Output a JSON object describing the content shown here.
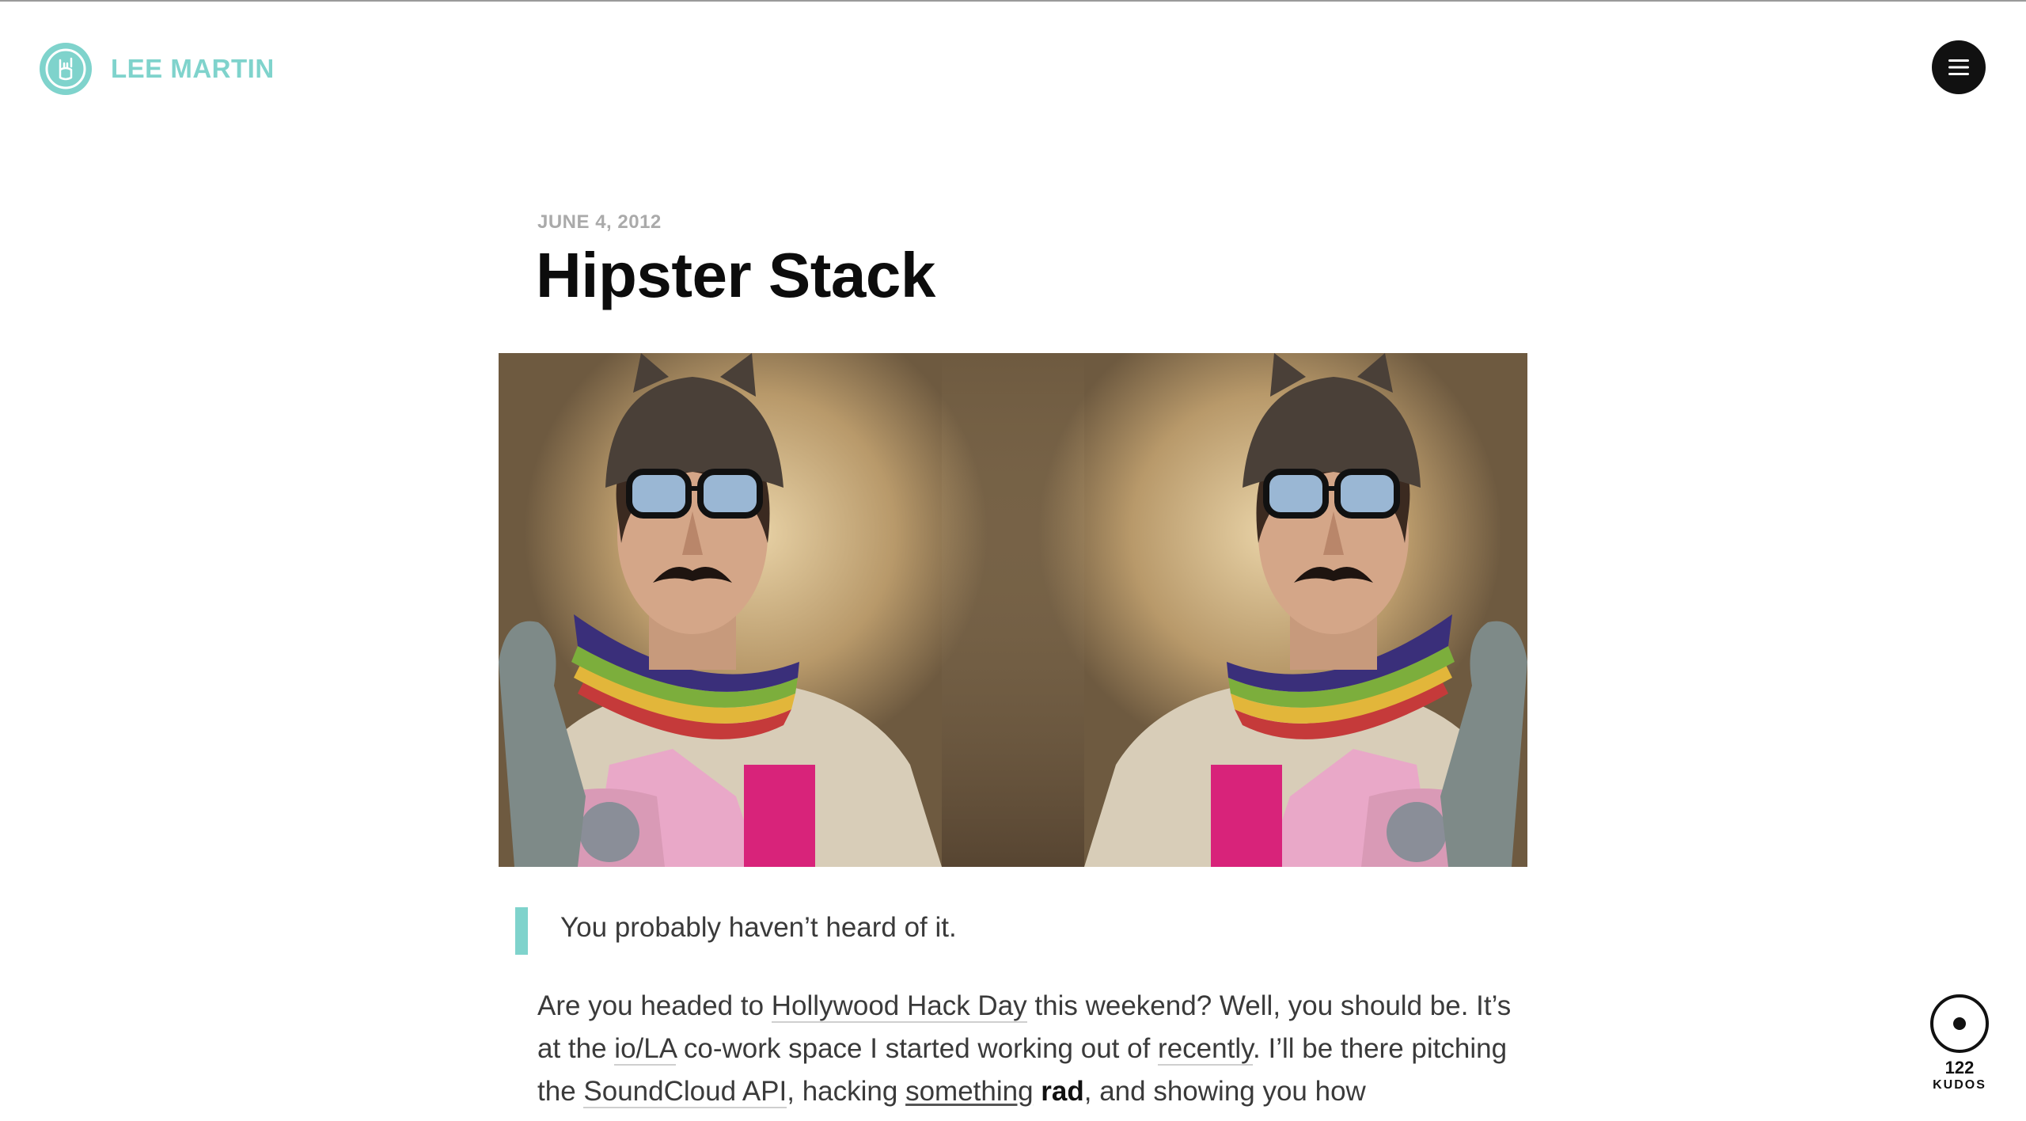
{
  "header": {
    "brand_name": "LEE MARTIN",
    "logo_icon": "hand-horns-icon",
    "menu_icon": "hamburger-menu-icon"
  },
  "post": {
    "date": "JUNE 4, 2012",
    "title": "Hipster Stack",
    "hero_image": "mirrored-portrait-photo",
    "pullquote": "You probably haven’t heard of it.",
    "paragraph": {
      "t1": "Are you headed to ",
      "link_hollywood": "Hollywood Hack Day",
      "t2": " this weekend? Well, you should be. It’s at the ",
      "link_iola": "io/LA",
      "t3": " co-work space I started working out of ",
      "link_recently": "recently",
      "t4": ". I’ll be there pitching the ",
      "link_soundcloud": "SoundCloud API",
      "t5": ", hacking ",
      "link_something": "something",
      "t6": " ",
      "bold_rad": "rad",
      "t7": ", and showing you how"
    }
  },
  "kudos": {
    "count": "122",
    "label": "KUDOS"
  },
  "colors": {
    "accent": "#7fd3cc",
    "text": "#3a3a3a",
    "title": "#0c0c0c",
    "date": "#aaaaaa"
  }
}
